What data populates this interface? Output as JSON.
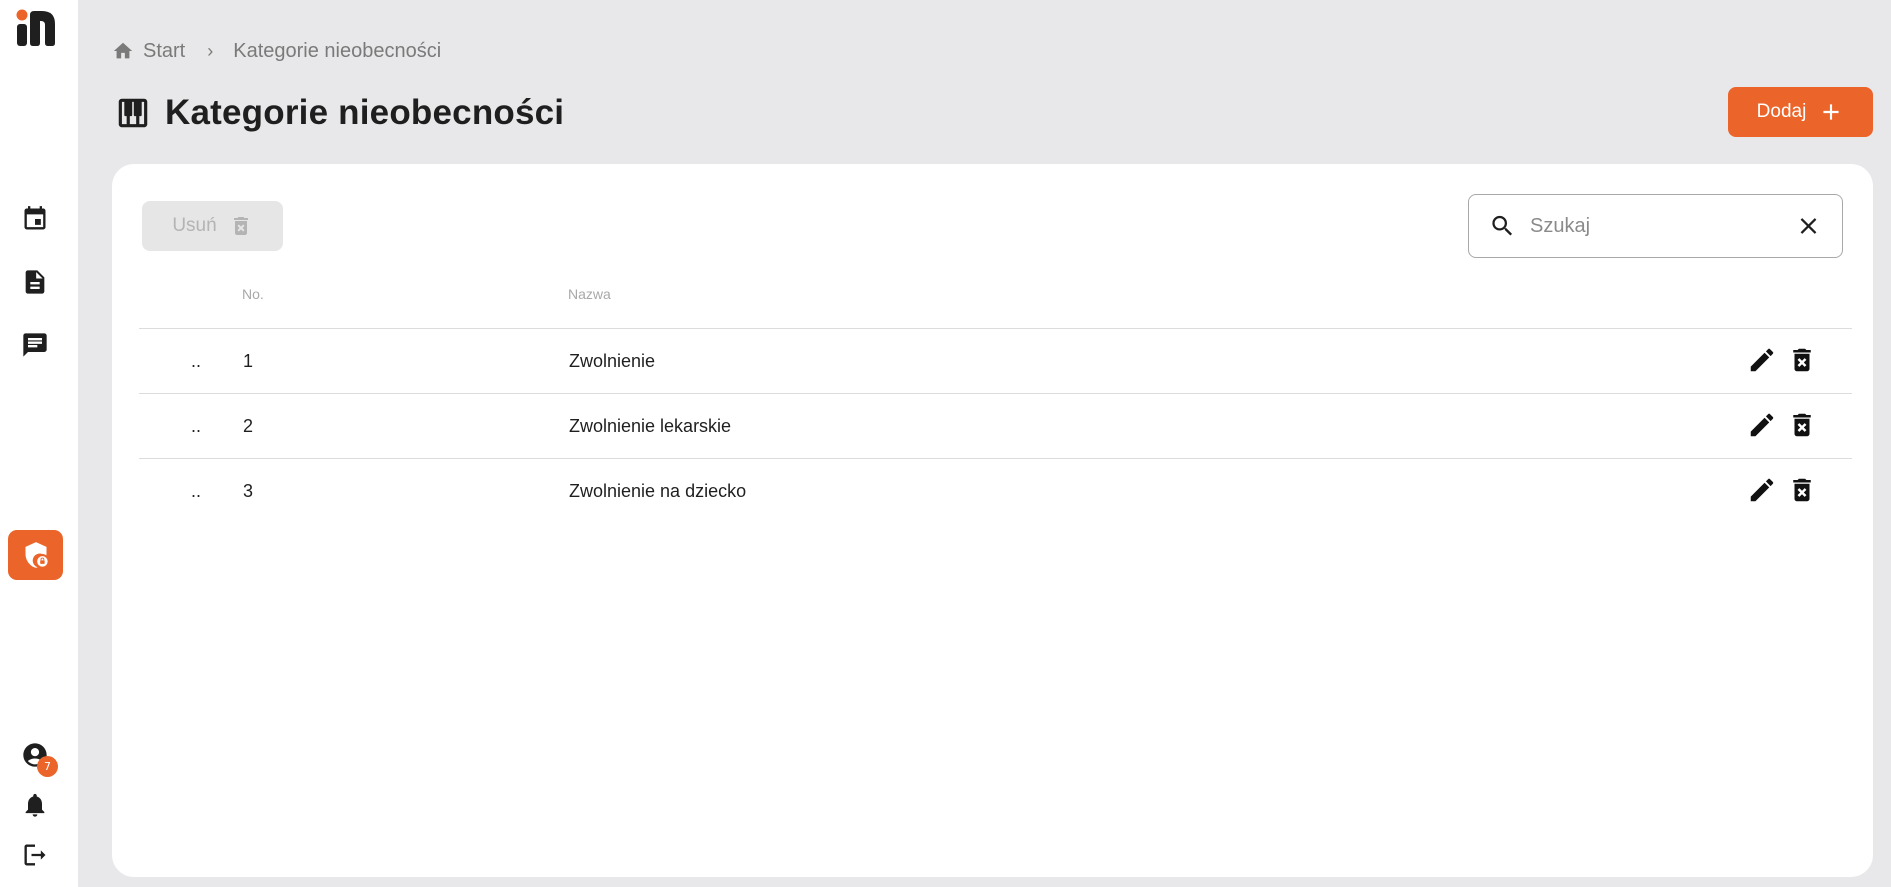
{
  "sidebar": {
    "logo": "app-logo",
    "items": [
      {
        "name": "calendar",
        "icon": "calendar-icon"
      },
      {
        "name": "documents",
        "icon": "document-icon"
      },
      {
        "name": "messages",
        "icon": "message-icon"
      },
      {
        "name": "security",
        "icon": "shield-lock-icon",
        "active": true
      }
    ],
    "bottom": {
      "account_icon": "account-icon",
      "account_badge": "7",
      "notifications_icon": "bell-icon",
      "logout_icon": "logout-icon"
    }
  },
  "breadcrumb": {
    "home_icon": "home-icon",
    "home_label": "Start",
    "separator": "›",
    "current": "Kategorie nieobecności"
  },
  "header": {
    "icon": "piano-icon",
    "title": "Kategorie nieobecności",
    "add_label": "Dodaj"
  },
  "toolbar": {
    "delete_label": "Usuń",
    "search_placeholder": "Szukaj"
  },
  "table": {
    "columns": [
      "No.",
      "Nazwa"
    ],
    "rows": [
      {
        "handle": "..",
        "no": "1",
        "name": "Zwolnienie"
      },
      {
        "handle": "..",
        "no": "2",
        "name": "Zwolnienie lekarskie"
      },
      {
        "handle": "..",
        "no": "3",
        "name": "Zwolnienie na dziecko"
      }
    ]
  },
  "colors": {
    "accent": "#eb6429",
    "background": "#e8e8ea",
    "card": "#ffffff"
  }
}
